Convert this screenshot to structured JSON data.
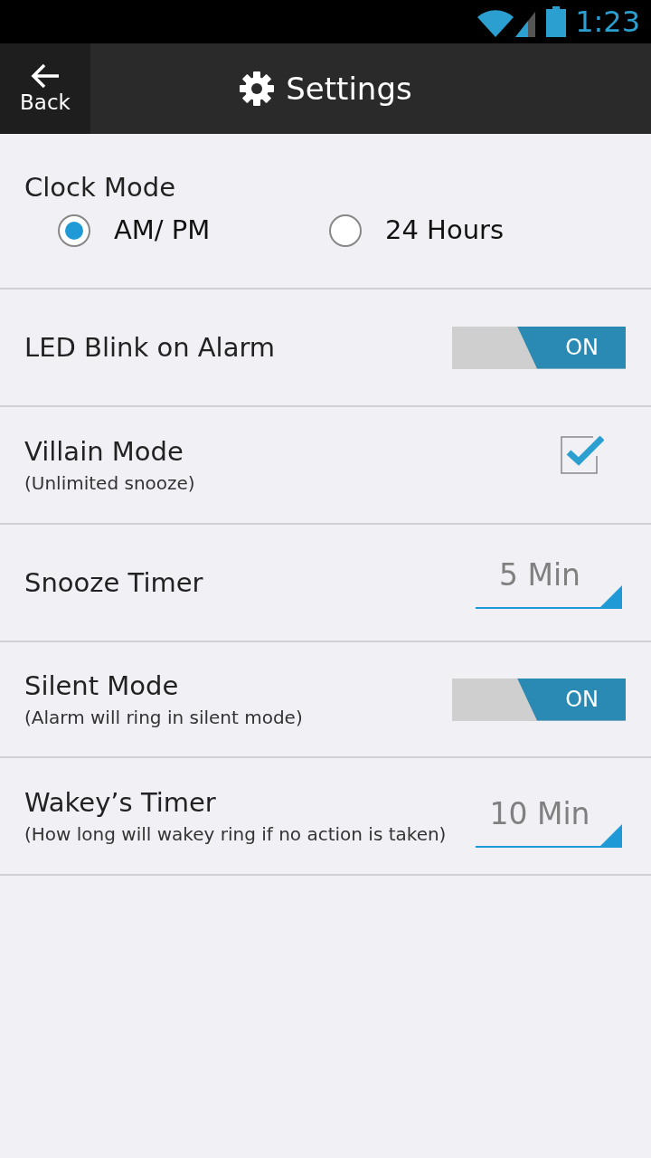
{
  "status_bar": {
    "time": "1:23"
  },
  "header": {
    "back_label": "Back",
    "title": "Settings"
  },
  "settings": [
    {
      "kind": "radio_group",
      "title": "Clock Mode",
      "options": [
        {
          "label": "AM/ PM",
          "selected": true
        },
        {
          "label": "24 Hours",
          "selected": false
        }
      ]
    },
    {
      "kind": "toggle",
      "title": "LED Blink on Alarm",
      "on": true,
      "state_label": "ON"
    },
    {
      "kind": "checkbox",
      "title": "Villain Mode",
      "subtitle": "(Unlimited snooze)",
      "checked": true
    },
    {
      "kind": "spinner",
      "title": "Snooze Timer",
      "value": "5 Min"
    },
    {
      "kind": "toggle",
      "title": "Silent Mode",
      "subtitle": "(Alarm will ring in silent mode)",
      "on": true,
      "state_label": "ON"
    },
    {
      "kind": "spinner",
      "title": "Wakey’s Timer",
      "subtitle": "(How long will wakey ring if no action is taken)",
      "value": "10 Min"
    }
  ]
}
